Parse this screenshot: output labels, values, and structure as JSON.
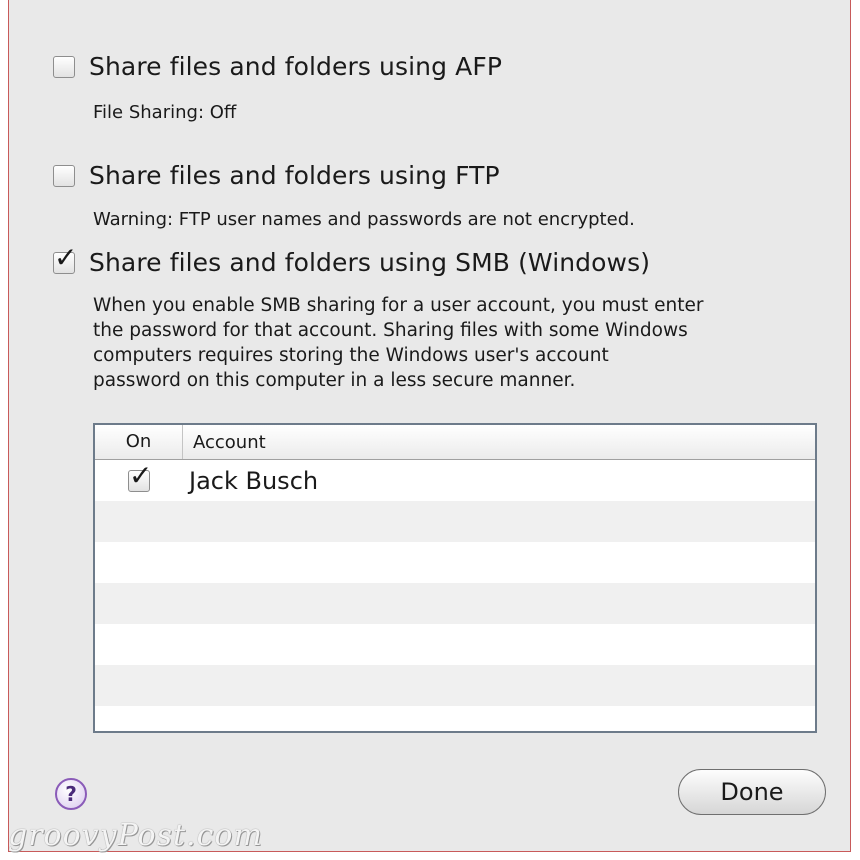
{
  "options": {
    "afp": {
      "label": "Share files and folders using AFP",
      "checked": false,
      "note": "File Sharing: Off"
    },
    "ftp": {
      "label": "Share files and folders using FTP",
      "checked": false,
      "note": "Warning: FTP user names and passwords are not encrypted."
    },
    "smb": {
      "label": "Share files and folders using SMB (Windows)",
      "checked": true,
      "description_lines": [
        "When you enable SMB sharing for a user account, you must enter",
        "the password for that account. Sharing files with some Windows",
        "computers requires storing the Windows user's account",
        "password on this computer in a less secure manner."
      ]
    }
  },
  "accounts_table": {
    "headers": {
      "on": "On",
      "account": "Account"
    },
    "rows": [
      {
        "on": true,
        "account": "Jack Busch"
      }
    ]
  },
  "buttons": {
    "help_glyph": "?",
    "done": "Done"
  },
  "watermark": "groovyPost.com",
  "colors": {
    "help_accent": "#8a5bb8",
    "panel_bg": "#e9e9e9",
    "table_border": "#6d7b8a"
  }
}
